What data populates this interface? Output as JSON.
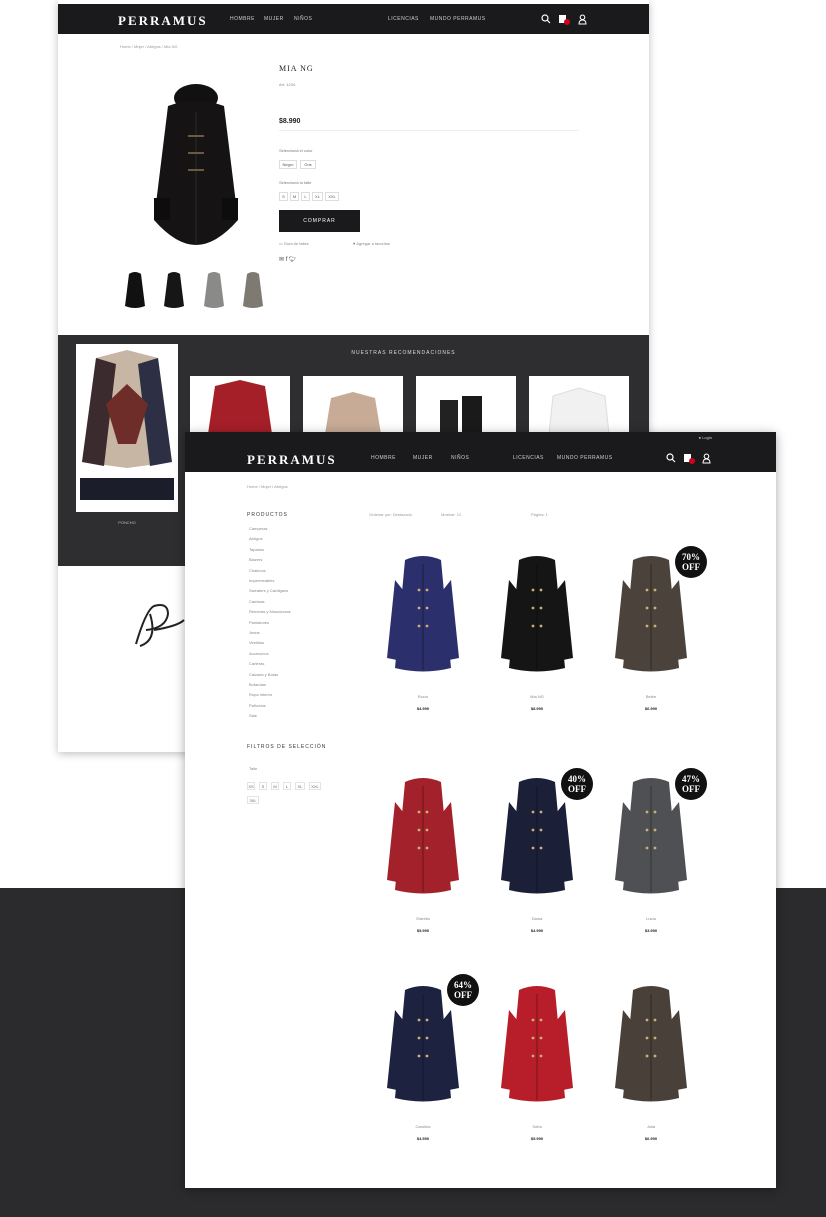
{
  "brand": "PERRAMUS",
  "detail_page": {
    "nav": {
      "links": [
        "HOMBRE",
        "MUJER",
        "NIÑOS",
        "LICENCIAS",
        "MUNDO PERRAMUS"
      ]
    },
    "breadcrumb": "Home / Mujer / Abrigos / Mia NG",
    "product": {
      "title": "MIA NG",
      "subtitle": "Art. 1234",
      "price": "$8.990",
      "color_label": "Seleccioná el color",
      "colors": [
        "Negro",
        "Gris"
      ],
      "size_label": "Seleccioná tu talle",
      "sizes": [
        "S",
        "M",
        "L",
        "XL",
        "XXL"
      ],
      "buy_label": "COMPRAR",
      "size_guide": "Guía de talles",
      "wishlist": "Agregar a favoritos"
    },
    "recommendations": {
      "title": "NUESTRAS RECOMENDACIONES",
      "featured_label": "PONCHO"
    },
    "colors": {
      "nav": "#1a1a1c",
      "band": "#2e2e30",
      "accent": "#c0392b"
    }
  },
  "catalog_page": {
    "strip_text": "Login",
    "nav": {
      "links": [
        "HOMBRE",
        "MUJER",
        "NIÑOS",
        "LICENCIAS",
        "MUNDO PERRAMUS"
      ]
    },
    "breadcrumb": "Home / Mujer / Abrigos",
    "filters": {
      "sort": "Ordenar por: Destacado",
      "view": "Mostrar: 12",
      "page": "Página: 1"
    },
    "sidebar": {
      "title": "PRODUCTOS",
      "items": [
        "Camperas",
        "Abrigos",
        "Tapados",
        "Blazers",
        "Chalecos",
        "Impermeables",
        "Sweaters y Cardigans",
        "Camisas",
        "Remeras y Musculosas",
        "Pantalones",
        "Jeans",
        "Vestidos",
        "Accesorios",
        "Carteras",
        "Calzado y Botas",
        "Bufandas",
        "Ropa Interior",
        "Pañuelos",
        "Sale"
      ],
      "filter_title": "FILTROS DE SELECCIÓN",
      "size_label": "Talle",
      "sizes": [
        "XS",
        "S",
        "M",
        "L",
        "XL",
        "XXL",
        "3XL"
      ]
    },
    "products": [
      {
        "name": "Rocío",
        "price": "$4.990",
        "badge": "",
        "color": "#2b2f6b"
      },
      {
        "name": "Mía NG",
        "price": "$8.990",
        "badge": "",
        "color": "#151515"
      },
      {
        "name": "Belén",
        "price": "$6.990",
        "badge": "70% OFF",
        "color": "#4a423b"
      },
      {
        "name": "Estrella",
        "price": "$5.990",
        "badge": "",
        "color": "#a3212b"
      },
      {
        "name": "Diana",
        "price": "$4.990",
        "badge": "40% OFF",
        "color": "#1b1f38"
      },
      {
        "name": "Lucía",
        "price": "$3.990",
        "badge": "47% OFF",
        "color": "#4f5053"
      },
      {
        "name": "Carolina",
        "price": "$4.590",
        "badge": "64% OFF",
        "color": "#1d2240"
      },
      {
        "name": "Sofía",
        "price": "$5.990",
        "badge": "",
        "color": "#b81e2a"
      },
      {
        "name": "Julia",
        "price": "$6.990",
        "badge": "",
        "color": "#4a403a"
      }
    ]
  }
}
